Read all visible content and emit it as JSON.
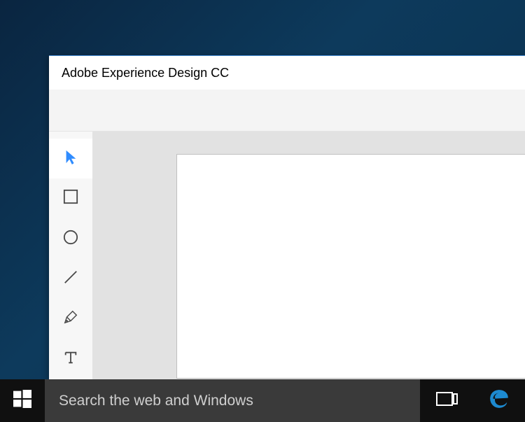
{
  "app": {
    "title": "Adobe Experience Design CC"
  },
  "tools": {
    "select": "select",
    "rectangle": "rectangle",
    "ellipse": "ellipse",
    "line": "line",
    "pen": "pen",
    "text": "text"
  },
  "taskbar": {
    "search_placeholder": "Search the web and Windows"
  },
  "colors": {
    "accent": "#2f8cff",
    "toolbar_bg": "#f7f7f7",
    "canvas_bg": "#e2e2e2",
    "taskbar_bg": "#101010",
    "searchbox_bg": "#3a3a3a",
    "edge_blue": "#1d8ad0"
  }
}
